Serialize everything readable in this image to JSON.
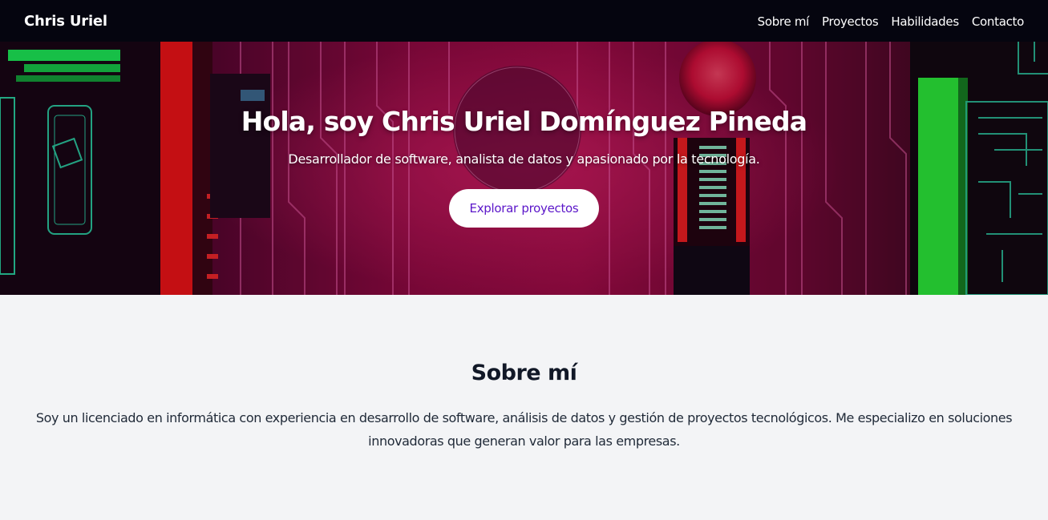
{
  "nav": {
    "brand": "Chris Uriel",
    "links": [
      "Sobre mí",
      "Proyectos",
      "Habilidades",
      "Contacto"
    ]
  },
  "hero": {
    "title": "Hola, soy Chris Uriel Domínguez Pineda",
    "subtitle": "Desarrollador de software, analista de datos y apasionado por la tecnología.",
    "button_label": "Explorar proyectos"
  },
  "about": {
    "title": "Sobre mí",
    "text": "Soy un licenciado en informática con experiencia en desarrollo de software, análisis de datos y gestión de proyectos tecnológicos. Me especializo en soluciones innovadoras que generan valor para las empresas."
  },
  "colors": {
    "nav_background": "#05050f",
    "button_text": "#5b16c9",
    "page_background": "#f3f4f6"
  }
}
